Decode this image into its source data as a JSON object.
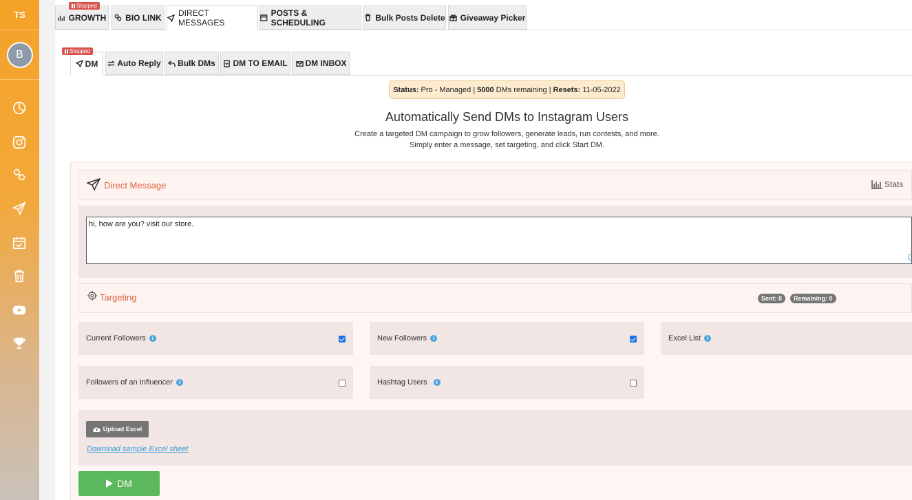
{
  "sidebar": {
    "brand": "TS",
    "avatar_initial": "B",
    "icons": [
      "pie-chart-icon",
      "instagram-icon",
      "link-icon",
      "send-icon",
      "calendar-check-icon",
      "trash-icon",
      "youtube-icon",
      "trophy-icon"
    ]
  },
  "top_tabs": {
    "stopped_badge": "Stopped",
    "growth": "GROWTH",
    "bio_link": "BIO LINK",
    "direct_messages": "DIRECT MESSAGES",
    "posts_scheduling": "POSTS & SCHEDULING",
    "bulk_posts_delete": "Bulk Posts Delete",
    "giveaway_picker": "Giveaway Picker"
  },
  "sub_tabs": {
    "stopped_badge": "Stopped",
    "dm": "DM",
    "auto_reply": "Auto Reply",
    "bulk_dms": "Bulk DMs",
    "dm_to_email": "DM TO EMAIL",
    "dm_inbox": "DM INBOX"
  },
  "status": {
    "label": "Status:",
    "plan": "Pro - Managed |",
    "dms_count": "5000",
    "dms_text": "DMs remaining |",
    "resets_label": "Resets:",
    "resets_date": "11-05-2022"
  },
  "header": {
    "title": "Automatically Send DMs to Instagram Users",
    "subtitle_1": "Create a targeted DM campaign to grow followers, generate leads, run contests, and more.",
    "subtitle_2": "Simply enter a message, set targeting, and click Start DM."
  },
  "direct_message": {
    "title": "Direct Message",
    "stats_label": "Stats",
    "message_value": "hi, how are you? visit our store."
  },
  "targeting": {
    "title": "Targeting",
    "sent": "Sent: 0",
    "remaining": "Remaining: 0",
    "options": {
      "current_followers": {
        "label": "Current Followers",
        "checked": true
      },
      "new_followers": {
        "label": "New Followers",
        "checked": true
      },
      "excel_list": {
        "label": "Excel List"
      },
      "followers_of_influencer": {
        "label": "Followers of an Influencer",
        "checked": false
      },
      "hashtag_users": {
        "label": "Hashtag Users",
        "checked": false
      }
    }
  },
  "upload": {
    "button": "Upload Excel",
    "download_link": "Download sample Excel sheet"
  },
  "dm_button": "DM",
  "colors": {
    "sidebar_top": "#f5a228",
    "accent_red": "#e0643c",
    "dm_green": "#5cb85c",
    "stopped_red": "#d9534f"
  }
}
